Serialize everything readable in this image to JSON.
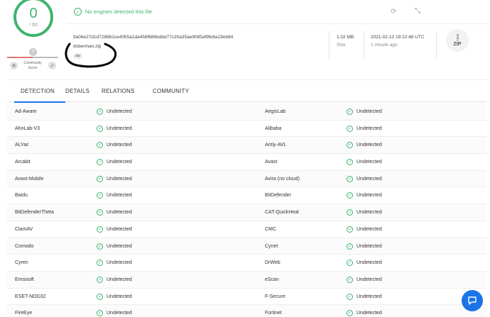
{
  "score": {
    "detections": "0",
    "total": "/ 60",
    "question": "?",
    "community_label": "Community Score",
    "down": "✕",
    "up": "✓"
  },
  "banner": {
    "text": "No engines detected this file"
  },
  "file": {
    "hash": "9a06e27d1d728861ce4055a1da458f686bdbd77c20a35ae9085af9fe8a19eb84",
    "name": "doberman.zip",
    "tag": "zip",
    "size": "1.02 MB",
    "size_label": "Size",
    "date": "2021-02-12 19:22:48 UTC",
    "date_ago": "1 minute ago",
    "type_badge": "ZIP"
  },
  "tabs": [
    {
      "label": "DETECTION"
    },
    {
      "label": "DETAILS"
    },
    {
      "label": "RELATIONS"
    },
    {
      "label": "COMMUNITY"
    }
  ],
  "results": [
    {
      "left": "Ad-Aware",
      "left_res": "Undetected",
      "right": "AegisLab",
      "right_res": "Undetected"
    },
    {
      "left": "AhnLab-V3",
      "left_res": "Undetected",
      "right": "Alibaba",
      "right_res": "Undetected"
    },
    {
      "left": "ALYac",
      "left_res": "Undetected",
      "right": "Antiy-AVL",
      "right_res": "Undetected"
    },
    {
      "left": "Arcabit",
      "left_res": "Undetected",
      "right": "Avast",
      "right_res": "Undetected"
    },
    {
      "left": "Avast-Mobile",
      "left_res": "Undetected",
      "right": "Avira (no cloud)",
      "right_res": "Undetected"
    },
    {
      "left": "Baidu",
      "left_res": "Undetected",
      "right": "BitDefender",
      "right_res": "Undetected"
    },
    {
      "left": "BitDefenderTheta",
      "left_res": "Undetected",
      "right": "CAT-QuickHeal",
      "right_res": "Undetected"
    },
    {
      "left": "ClamAV",
      "left_res": "Undetected",
      "right": "CMC",
      "right_res": "Undetected"
    },
    {
      "left": "Comodo",
      "left_res": "Undetected",
      "right": "Cynet",
      "right_res": "Undetected"
    },
    {
      "left": "Cyren",
      "left_res": "Undetected",
      "right": "DrWeb",
      "right_res": "Undetected"
    },
    {
      "left": "Emsisoft",
      "left_res": "Undetected",
      "right": "eScan",
      "right_res": "Undetected"
    },
    {
      "left": "ESET-NOD32",
      "left_res": "Undetected",
      "right": "F-Secure",
      "right_res": "Undetected"
    },
    {
      "left": "FireEye",
      "left_res": "Undetected",
      "right": "Fortinet",
      "right_res": "Undetected"
    }
  ],
  "colors": {
    "clean": "#3db46d",
    "accent": "#1a73e8"
  }
}
